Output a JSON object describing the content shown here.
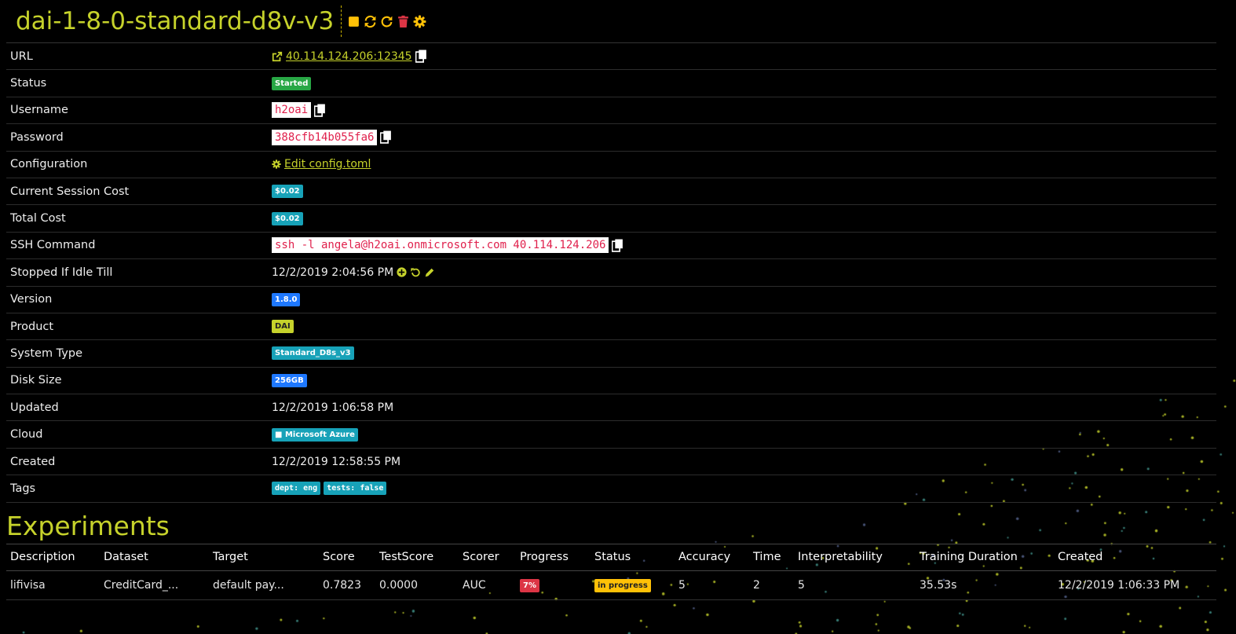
{
  "header": {
    "title": "dai-1-8-0-standard-d8v-v3",
    "actions": [
      {
        "icon": "stop-icon",
        "color": "#ffc107"
      },
      {
        "icon": "sync-icon",
        "color": "#ffc107"
      },
      {
        "icon": "restart-icon",
        "color": "#ffc107"
      },
      {
        "icon": "trash-icon",
        "color": "#dc3545"
      },
      {
        "icon": "gear-icon",
        "color": "#ffc107"
      }
    ]
  },
  "details": {
    "url": {
      "label": "URL",
      "value": "40.114.124.206:12345"
    },
    "status": {
      "label": "Status",
      "value": "Started"
    },
    "username": {
      "label": "Username",
      "value": "h2oai"
    },
    "password": {
      "label": "Password",
      "value": "388cfb14b055fa6"
    },
    "configuration": {
      "label": "Configuration",
      "value": "Edit config.toml"
    },
    "session_cost": {
      "label": "Current Session Cost",
      "value": "$0.02"
    },
    "total_cost": {
      "label": "Total Cost",
      "value": "$0.02"
    },
    "ssh": {
      "label": "SSH Command",
      "value": "ssh -l angela@h2oai.onmicrosoft.com 40.114.124.206"
    },
    "idle": {
      "label": "Stopped If Idle Till",
      "value": "12/2/2019 2:04:56 PM"
    },
    "version": {
      "label": "Version",
      "value": "1.8.0"
    },
    "product": {
      "label": "Product",
      "value": "DAI"
    },
    "system_type": {
      "label": "System Type",
      "value": "Standard_D8s_v3"
    },
    "disk_size": {
      "label": "Disk Size",
      "value": "256GB"
    },
    "updated": {
      "label": "Updated",
      "value": "12/2/2019 1:06:58 PM"
    },
    "cloud": {
      "label": "Cloud",
      "value": "Microsoft Azure"
    },
    "created": {
      "label": "Created",
      "value": "12/2/2019 12:58:55 PM"
    },
    "tags": {
      "label": "Tags",
      "values": [
        "dept: eng",
        "tests: false"
      ]
    }
  },
  "experiments": {
    "title": "Experiments",
    "columns": [
      "Description",
      "Dataset",
      "Target",
      "Score",
      "TestScore",
      "Scorer",
      "Progress",
      "Status",
      "Accuracy",
      "Time",
      "Interpretability",
      "Training Duration",
      "Created"
    ],
    "rows": [
      {
        "description": "lifivisa",
        "dataset": "CreditCard_...",
        "target": "default pay...",
        "score": "0.7823",
        "test_score": "0.0000",
        "scorer": "AUC",
        "progress": "7%",
        "status": "in progress",
        "accuracy": "5",
        "time": "2",
        "interpretability": "5",
        "training_duration": "35.53s",
        "created": "12/2/2019 1:06:33 PM"
      }
    ]
  },
  "colors": {
    "accent": "#c6d22b",
    "background": "#000000",
    "dots": "#c6d22b"
  }
}
